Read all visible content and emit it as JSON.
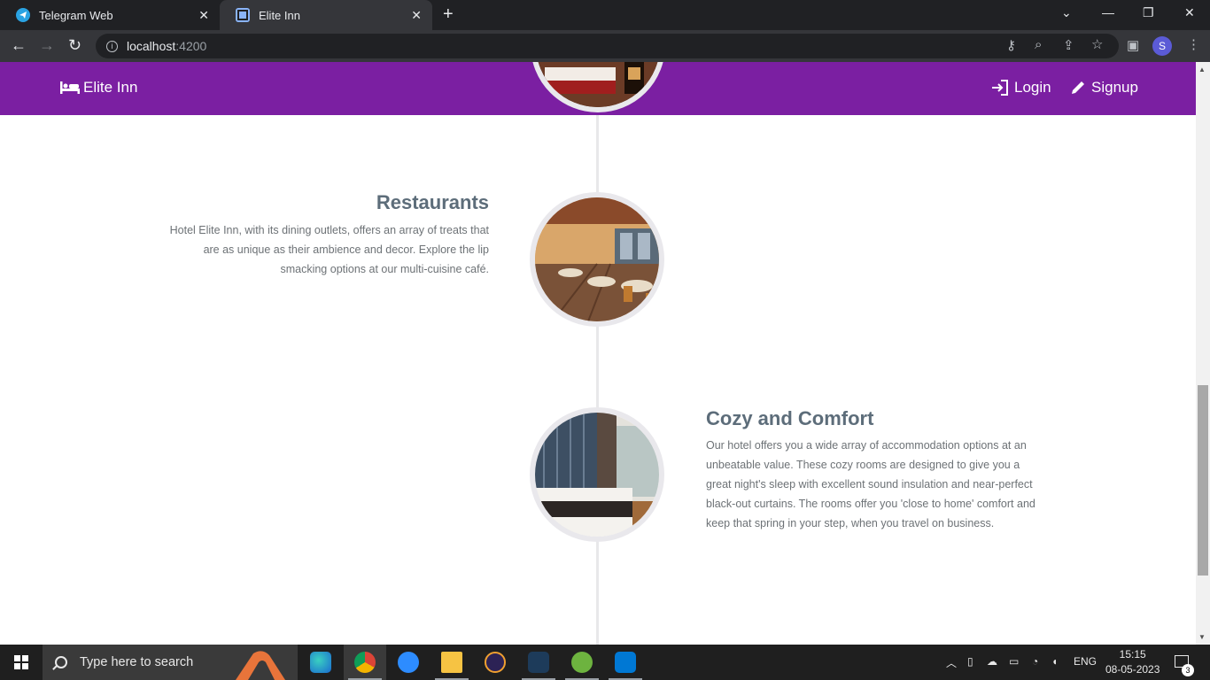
{
  "browser": {
    "tabs": [
      {
        "title": "Telegram Web",
        "active": false
      },
      {
        "title": "Elite Inn",
        "active": true
      }
    ],
    "url_host": "localhost",
    "url_port": ":4200",
    "profile_initial": "S"
  },
  "site": {
    "brand": "Elite Inn",
    "nav": {
      "login": "Login",
      "signup": "Signup"
    },
    "colors": {
      "navbar": "#7b1fa2",
      "heading": "#5d6d7a",
      "body_text": "#6d7276"
    },
    "sections": [
      {
        "title": "Restaurants",
        "text": "Hotel Elite Inn, with its dining outlets, offers an array of treats that are as unique as their ambience and decor. Explore the lip smacking options at our multi-cuisine café.",
        "align": "left"
      },
      {
        "title": "Cozy and Comfort",
        "text": "Our hotel offers you a wide array of accommodation options at an unbeatable value. These cozy rooms are designed to give you a great night's sleep with excellent sound insulation and near-perfect black-out curtains. The rooms offer you 'close to home' comfort and keep that spring in your step, when you travel on business.",
        "align": "right"
      }
    ]
  },
  "taskbar": {
    "search_placeholder": "Type here to search",
    "language": "ENG",
    "time": "15:15",
    "date": "08-05-2023",
    "notifications": "3"
  }
}
